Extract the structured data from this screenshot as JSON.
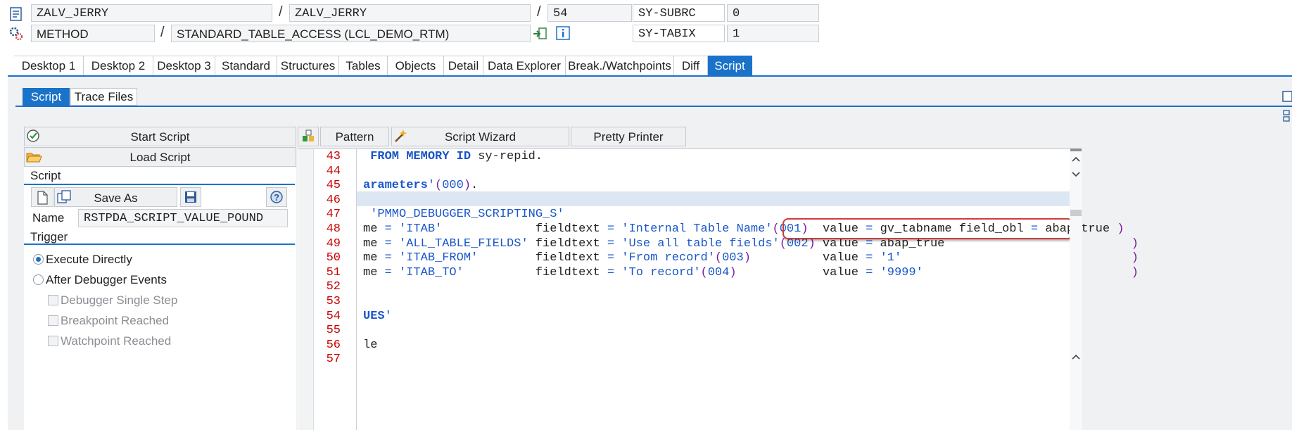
{
  "header": {
    "row1": {
      "program": "ZALV_JERRY",
      "include": "ZALV_JERRY",
      "line": "54",
      "sysvar_name": "SY-SUBRC",
      "sysvar_value": "0"
    },
    "row2": {
      "type": "METHOD",
      "name": "STANDARD_TABLE_ACCESS (LCL_DEMO_RTM)",
      "sysvar_name": "SY-TABIX",
      "sysvar_value": "1"
    },
    "separator": "/"
  },
  "main_tabs": [
    "Desktop 1",
    "Desktop 2",
    "Desktop 3",
    "Standard",
    "Structures",
    "Tables",
    "Objects",
    "Detail",
    "Data Explorer",
    "Break./Watchpoints",
    "Diff",
    "Script"
  ],
  "main_tabs_active": "Script",
  "sub_tabs": [
    "Script",
    "Trace Files"
  ],
  "sub_tabs_active": "Script",
  "left_panel": {
    "start_script": "Start Script",
    "load_script": "Load Script",
    "script_section": "Script",
    "save_as": "Save As",
    "name_label": "Name",
    "name_value": "RSTPDA_SCRIPT_VALUE_POUND",
    "trigger_section": "Trigger",
    "execute_directly": "Execute Directly",
    "after_events": "After Debugger Events",
    "single_step": "Debugger Single Step",
    "breakpoint_reached": "Breakpoint Reached",
    "watchpoint_reached": "Watchpoint Reached"
  },
  "editor_toolbar": {
    "pattern": "Pattern",
    "script_wizard": "Script Wizard",
    "pretty_printer": "Pretty Printer"
  },
  "editor": {
    "line_numbers": [
      "43",
      "44",
      "45",
      "46",
      "47",
      "48",
      "49",
      "50",
      "51",
      "52",
      "53",
      "54",
      "55",
      "56",
      "57"
    ]
  },
  "colors": {
    "accent": "#1a72c9",
    "keyword": "#1a56c8",
    "line_number": "#cc0000",
    "highlight_box": "#d23a3a",
    "current_line": "#dde7f3"
  }
}
